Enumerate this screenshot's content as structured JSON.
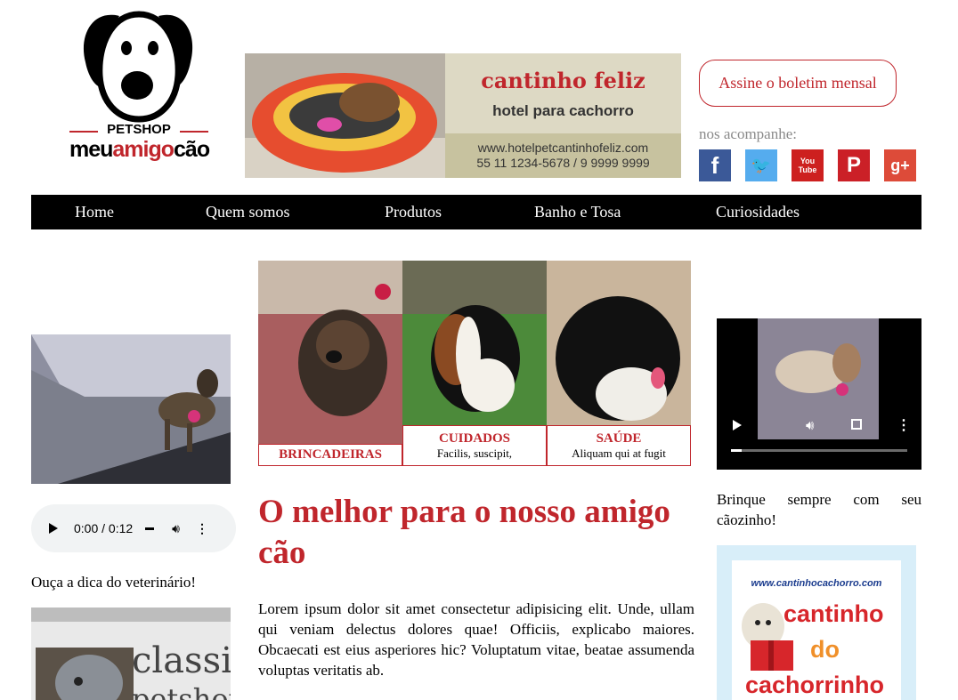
{
  "header": {
    "logo": {
      "petshop": "PETSHOP",
      "brand_part1": "meu",
      "brand_part2": "amigo",
      "brand_part3": "cão"
    },
    "banner": {
      "title": "cantinho feliz",
      "subtitle": "hotel para cachorro",
      "url": "www.hotelpetcantinhofeliz.com",
      "phone": "55 11 1234-5678 / 9 9999 9999"
    },
    "newsletter_label": "Assine o boletim mensal",
    "follow_label": "nos acompanhe:",
    "socials": [
      {
        "name": "facebook",
        "glyph": "f",
        "color": "#3b5998"
      },
      {
        "name": "twitter",
        "glyph": "🐦",
        "color": "#55acee"
      },
      {
        "name": "youtube",
        "glyph": "You Tube",
        "color": "#cd201f"
      },
      {
        "name": "pinterest",
        "glyph": "P",
        "color": "#cb2027"
      },
      {
        "name": "google-plus",
        "glyph": "g+",
        "color": "#dd4b39"
      }
    ]
  },
  "nav": {
    "items": [
      "Home",
      "Quem somos",
      "Produtos",
      "Banho e Tosa",
      "Curiosidades"
    ]
  },
  "left": {
    "audio": {
      "time": "0:00 / 0:12"
    },
    "vet_tip": "Ouça a dica do veterinário!",
    "ad_text": "classic",
    "ad_text2": "petshop"
  },
  "center": {
    "cards": [
      {
        "title": "BRINCADEIRAS",
        "snippet": ""
      },
      {
        "title": "CUIDADOS",
        "snippet": "Facilis, suscipit,"
      },
      {
        "title": "SAÚDE",
        "snippet": "Aliquam qui at fugit"
      }
    ],
    "headline": "O melhor para o nosso amigo cão",
    "body": "Lorem ipsum dolor sit amet consectetur adipisicing elit. Unde, ullam qui veniam delectus dolores quae! Officiis, explicabo maiores. Obcaecati est eius asperiores hic? Voluptatum vitae, beatae assumenda voluptas veritatis ab."
  },
  "right": {
    "video_caption": "Brinque sempre com seu cãozinho!",
    "ad": {
      "url": "www.cantinhocachorro.com",
      "line1": "cantinho",
      "line2": "do",
      "line3": "cachorrinho"
    }
  },
  "colors": {
    "accent": "#c0262c",
    "nav_bg": "#000000"
  }
}
